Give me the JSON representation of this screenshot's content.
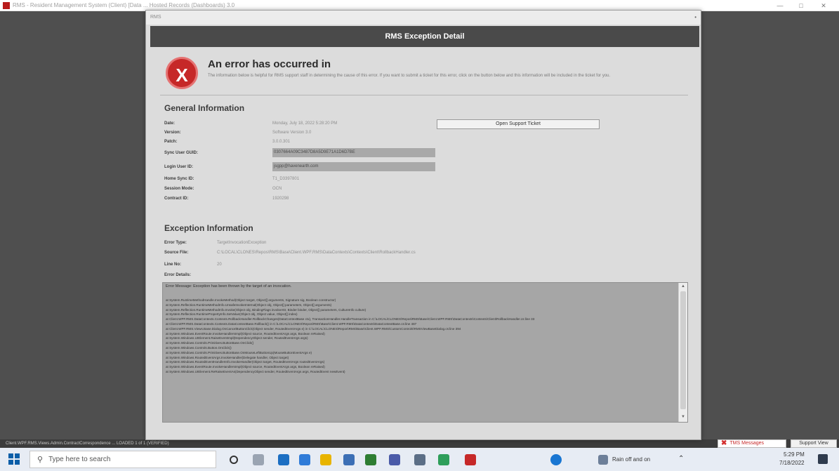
{
  "app": {
    "title": "RMS - Resident Management System (Client) [Data ... Hosted Records (Dashboards) 3.0",
    "status_text": "Client.WPF.RMS.Views.Admin.ContractCorrespondence ... LOADED 1 of 1 (VERIFIED)",
    "tms_label": "TMS Messages",
    "support_view_label": "Support View"
  },
  "dialog": {
    "window_title": "RMS",
    "header": "RMS Exception Detail",
    "error_title": "An error has occurred in",
    "error_description": "The information below is helpful for RMS support staff in determining the cause of this error. If you want to submit a ticket for this error, click on the button below and this information will be included in the ticket for you.",
    "open_ticket_label": "Open Support Ticket"
  },
  "general": {
    "title": "General Information",
    "fields": [
      {
        "label": "Date:",
        "value": "Monday, July 18, 2022 5:28:20 PM"
      },
      {
        "label": "Version:",
        "value": "Software Version 3.0"
      },
      {
        "label": "Patch:",
        "value": "3.0.0.301"
      },
      {
        "label": "Sync User GUID:",
        "value": "0307664A09C3487D8A5D9E71A1D6D7BE"
      },
      {
        "label": "Login User ID:",
        "value": "jsgpp@havenearth.com"
      },
      {
        "label": "Home Sync ID:",
        "value": "T1_D3397801"
      },
      {
        "label": "Session Mode:",
        "value": "OCN"
      },
      {
        "label": "Contract ID:",
        "value": "1920298"
      }
    ]
  },
  "exception": {
    "title": "Exception Information",
    "error_type_label": "Error Type:",
    "error_type": "TargetInvocationException",
    "source_file_label": "Source File:",
    "source_file": "C:\\LOCAL\\CLONES\\Repos\\RMS\\Base\\Client.WPF.RMS\\DataContexts\\Contexts\\Client\\RollbackHandler.cs",
    "line_no_label": "Line No:",
    "line_no": "20",
    "error_details_label": "Error Details:",
    "error_message": "Error Message: Exception has been thrown by the target of an invocation.",
    "stack": [
      "at System.RuntimeMethodHandle.InvokeMethod(Object target, Object[] arguments, Signature sig, Boolean constructor)",
      "at System.Reflection.RuntimeMethodInfo.UnsafeInvokeInternal(Object obj, Object[] parameters, Object[] arguments)",
      "at System.Reflection.RuntimeMethodInfo.Invoke(Object obj, BindingFlags invokeAttr, Binder binder, Object[] parameters, CultureInfo culture)",
      "at System.Reflection.RuntimePropertyInfo.SetValue(Object obj, Object value, Object[] index)",
      "at Client.WPF.RMS.DataContexts.Contexts.RollbackHandler.RollbackChanges(DataContextBase ctx), TransactionHandler.HandleTransaction in C:\\LOCAL\\CLONES\\Repos\\RMS\\Base\\Client.WPF.RMS\\DataContexts\\Contexts\\Client\\RollbackHandler.cs:line 33",
      "at Client.WPF.RMS.DataContexts.Contexts.DataContextBase.Rollback() in C:\\LOCAL\\CLONES\\Repos\\RMS\\Base\\Client.WPF.RMS\\DataContexts\\DataContextBase.cs:line 487",
      "at Client.WPF.RMS.Views.Base.Dialog.OnCancelButtonClick(Object sender, RoutedEventArgs e) in C:\\LOCAL\\CLONES\\Repos\\RMS\\Base\\Client.WPF.RMS\\CustomControls\\RMSViewBaseDialog.cs:line 394",
      "at System.Windows.EventRoute.InvokeHandlersImpl(Object source, RoutedEventArgs args, Boolean reRaised)",
      "at System.Windows.UIElement.RaiseEventImpl(DependencyObject sender, RoutedEventArgs args)",
      "at System.Windows.Controls.Primitives.ButtonBase.OnClick()",
      "at System.Windows.Controls.Button.OnClick()",
      "at System.Windows.Controls.Primitives.ButtonBase.OnMouseLeftButtonUp(MouseButtonEventArgs e)",
      "at System.Windows.RoutedEventArgs.InvokeHandler(Delegate handler, Object target)",
      "at System.Windows.RoutedEventHandlerInfo.InvokeHandler(Object target, RoutedEventArgs routedEventArgs)",
      "at System.Windows.EventRoute.InvokeHandlersImpl(Object source, RoutedEventArgs args, Boolean reRaised)",
      "at System.Windows.UIElement.ReRaiseEventAs(DependencyObject sender, RoutedEventArgs args, RoutedEvent newEvent)"
    ]
  },
  "taskbar": {
    "search_placeholder": "Type here to search",
    "weather": "Rain off and on",
    "time": "5:29 PM",
    "date": "7/18/2022"
  }
}
